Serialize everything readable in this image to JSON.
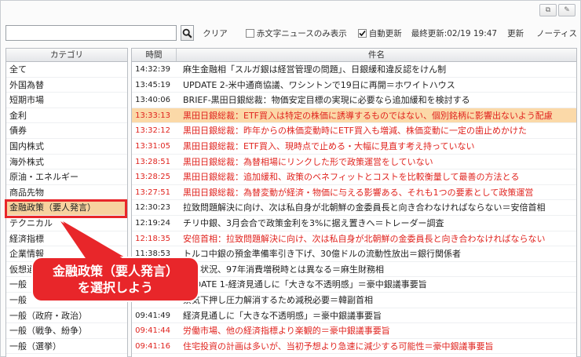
{
  "window_buttons": [
    {
      "icon": "restore-icon",
      "glyph": "⧉"
    },
    {
      "icon": "pin-icon",
      "glyph": "✎"
    }
  ],
  "toolbar": {
    "search_value": "",
    "clear_label": "クリア",
    "red_only_label": "赤文字ニュースのみ表示",
    "red_only_checked": false,
    "auto_update_label": "自動更新",
    "auto_update_checked": true,
    "last_update_label": "最終更新:02/19 19:47",
    "refresh_label": "更新",
    "notice_label": "ノーティス"
  },
  "categories": {
    "header": "カテゴリ",
    "selected_index": 12,
    "items": [
      "全て",
      "外国為替",
      "短期市場",
      "金利",
      "債券",
      "国内株式",
      "海外株式",
      "原油・エネルギー",
      "商品先物",
      "金融政策（要人発言）",
      "テクニカル",
      "経済指標",
      "企業情報",
      "仮想通貨",
      "一般",
      "一般",
      "一般（政府・政治）",
      "一般（戦争、紛争）",
      "一般（選挙）"
    ]
  },
  "news": {
    "header_time": "時間",
    "header_title": "件名",
    "rows": [
      {
        "time": "14:32:39",
        "title": "麻生金融相「スルガ銀は経営管理の問題」、日銀緩和違反認をけん制",
        "red": false,
        "selected": false
      },
      {
        "time": "13:45:19",
        "title": "UPDATE 2-米中通商協議、ワシントンで19日に再開＝ホワイトハウス",
        "red": false,
        "selected": false
      },
      {
        "time": "13:40:06",
        "title": "BRIEF-黒田日銀総裁：物価安定目標の実現に必要なら追加緩和を検討する",
        "red": false,
        "selected": false
      },
      {
        "time": "13:33:13",
        "title": "黒田日銀総裁：ETF買入は特定の株価に誘導するものではない、個別銘柄に影響出ないよう配慮",
        "red": true,
        "selected": true
      },
      {
        "time": "13:32:12",
        "title": "黒田日銀総裁：昨年からの株価変動時にETF買入も増減、株価変動に一定の歯止めかけた",
        "red": true,
        "selected": false
      },
      {
        "time": "13:31:05",
        "title": "黒田日銀総裁：ETF買入、現時点で止める・大幅に見直す考え持っていない",
        "red": true,
        "selected": false
      },
      {
        "time": "13:28:51",
        "title": "黒田日銀総裁：為替相場にリンクした形で政策運営をしていない",
        "red": true,
        "selected": false
      },
      {
        "time": "13:28:25",
        "title": "黒田日銀総裁：追加緩和、政策のベネフィットとコストを比較衡量して最善の方法とる",
        "red": true,
        "selected": false
      },
      {
        "time": "13:27:51",
        "title": "黒田日銀総裁：為替変動が経済・物価に与える影響ある、それも1つの要素として政策運営",
        "red": true,
        "selected": false
      },
      {
        "time": "12:30:23",
        "title": "拉致問題解決に向け、次は私自身が北朝鮮の金委員長と向き合わなければならない＝安倍首相",
        "red": false,
        "selected": false
      },
      {
        "time": "12:19:24",
        "title": "チリ中銀、3月会合で政策金利を3%に据え置きへ＝トレーダー調査",
        "red": false,
        "selected": false
      },
      {
        "time": "12:18:35",
        "title": "安倍首相：拉致問題解決に向け、次は私自身が北朝鮮の金委員長と向き合わなければならない",
        "red": true,
        "selected": false
      },
      {
        "time": "11:38:53",
        "title": "トルコ中銀の預金準備率引き下げ、30億ドルの流動性放出＝銀行関係者",
        "red": false,
        "selected": false
      },
      {
        "time": "",
        "title": "今の状況、97年消費増税時とは異なる＝麻生財務相",
        "red": false,
        "selected": false
      },
      {
        "time": "",
        "title": "UPDATE 1-経済見通しに「大きな不透明感」＝豪中銀議事要旨",
        "red": false,
        "selected": false
      },
      {
        "time": "",
        "title": "景気下押し圧力解消するため減税必要＝韓副首相",
        "red": false,
        "selected": false
      },
      {
        "time": "09:41:49",
        "title": "経済見通しに「大きな不透明感」＝豪中銀議事要旨",
        "red": false,
        "selected": false
      },
      {
        "time": "09:41:44",
        "title": "労働市場、他の経済指標より楽観的＝豪中銀議事要旨",
        "red": true,
        "selected": false
      },
      {
        "time": "09:41:16",
        "title": "住宅投資の計画は多いが、当初予想より急速に減少する可能性＝豪中銀議事要旨",
        "red": true,
        "selected": false
      }
    ]
  },
  "callout": {
    "line1": "金融政策（要人発言）",
    "line2": "を選択しよう",
    "color": "#e8262a"
  },
  "colors": {
    "selected_category_bg": "#f7d29f",
    "selected_row_bg": "#fbd9a8",
    "red_news": "#e0241f"
  }
}
